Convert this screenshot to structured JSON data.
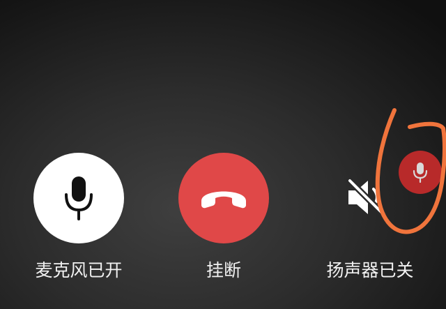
{
  "colors": {
    "mic_button_bg": "#ffffff",
    "mic_icon": "#111111",
    "hangup_button_bg": "#e04848",
    "hangup_icon": "#ffffff",
    "speaker_icon": "#ffffff",
    "floating_mic_bg": "#b82a2a",
    "floating_mic_icon": "#d9d9d9",
    "annotation_stroke": "#f0743c",
    "label_text": "#f2f2f2"
  },
  "controls": {
    "microphone": {
      "label": "麦克风已开",
      "icon": "microphone-icon",
      "state": "on"
    },
    "hangup": {
      "label": "挂断",
      "icon": "phone-hangup-icon"
    },
    "speaker": {
      "label": "扬声器已关",
      "icon": "speaker-muted-icon",
      "state": "off"
    },
    "floating_mic": {
      "icon": "microphone-icon"
    }
  },
  "annotation": {
    "shape": "hand-drawn-circle",
    "target": "floating-mic-indicator"
  }
}
